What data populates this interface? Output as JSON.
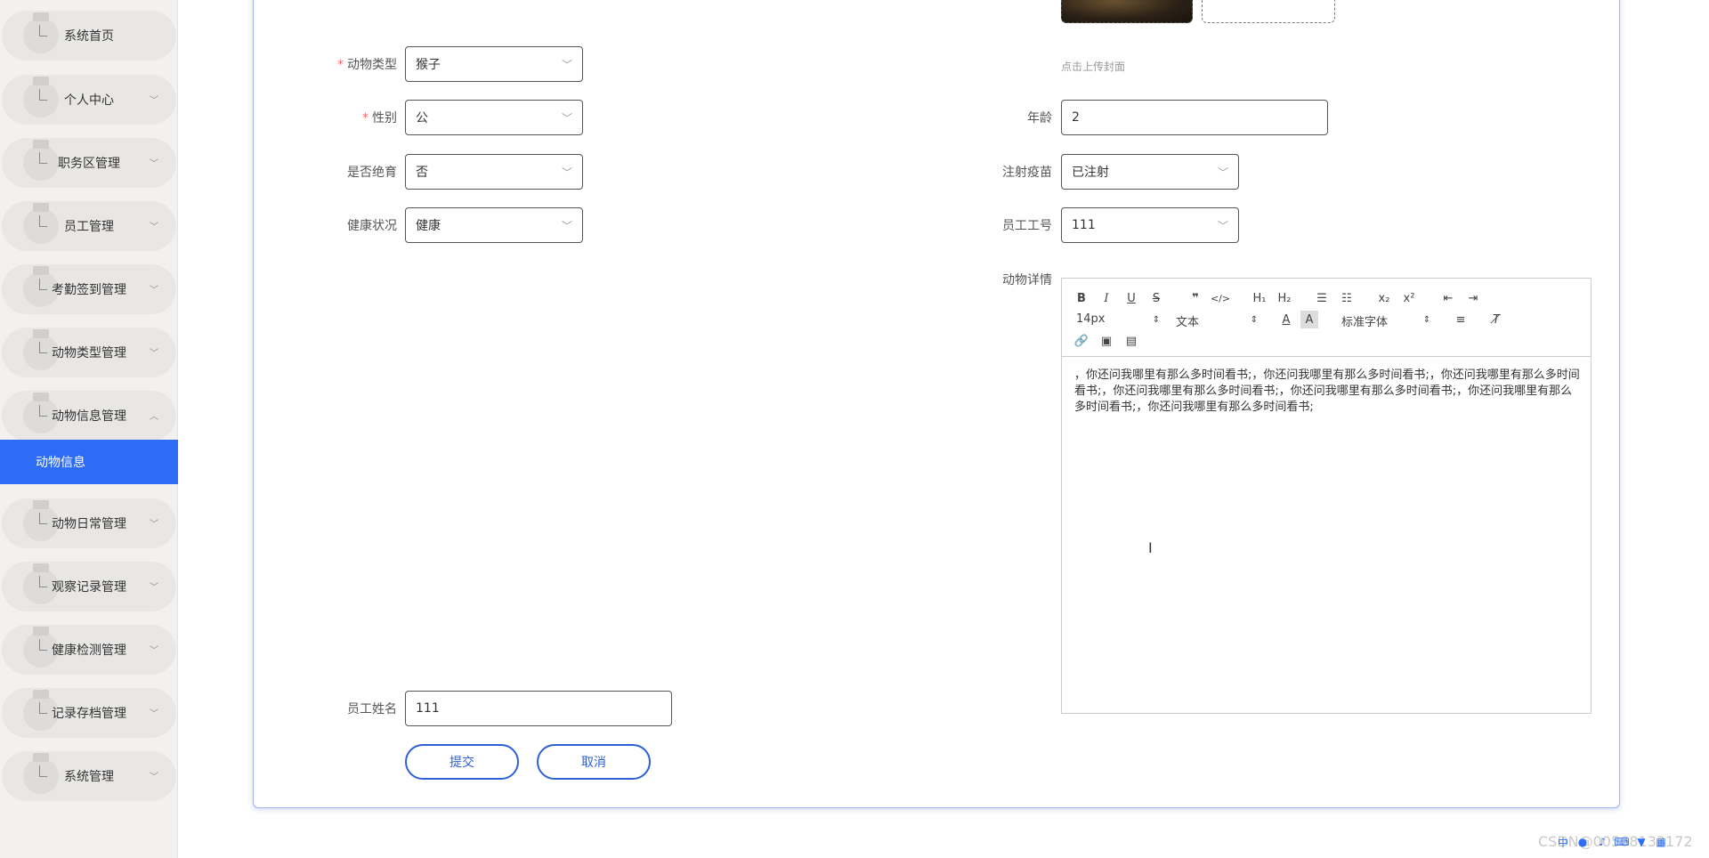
{
  "sidebar": {
    "items": [
      {
        "label": "系统首页",
        "has_arrow": false
      },
      {
        "label": "个人中心",
        "has_arrow": true
      },
      {
        "label": "职务区管理",
        "has_arrow": true
      },
      {
        "label": "员工管理",
        "has_arrow": true
      },
      {
        "label": "考勤签到管理",
        "has_arrow": true
      },
      {
        "label": "动物类型管理",
        "has_arrow": true
      },
      {
        "label": "动物信息管理",
        "has_arrow": true,
        "expanded": true
      },
      {
        "label": "动物日常管理",
        "has_arrow": true
      },
      {
        "label": "观察记录管理",
        "has_arrow": true
      },
      {
        "label": "健康检测管理",
        "has_arrow": true
      },
      {
        "label": "记录存档管理",
        "has_arrow": true
      },
      {
        "label": "系统管理",
        "has_arrow": true
      }
    ],
    "active_sub": "动物信息"
  },
  "form": {
    "upload_hint": "点击上传封面",
    "animal_type": {
      "label": "动物类型",
      "value": "猴子"
    },
    "gender": {
      "label": "性别",
      "value": "公"
    },
    "age": {
      "label": "年龄",
      "value": "2"
    },
    "sterilized": {
      "label": "是否绝育",
      "value": "否"
    },
    "vaccine": {
      "label": "注射疫苗",
      "value": "已注射"
    },
    "health": {
      "label": "健康状况",
      "value": "健康"
    },
    "employee_id": {
      "label": "员工工号",
      "value": "111"
    },
    "details_label": "动物详情",
    "employee_name": {
      "label": "员工姓名",
      "value": "111"
    },
    "submit": "提交",
    "cancel": "取消"
  },
  "editor": {
    "font_size": "14px",
    "block_type": "文本",
    "font_family": "标准字体",
    "content": "，你还问我哪里有那么多时间看书;，你还问我哪里有那么多时间看书;，你还问我哪里有那么多时间看书;，你还问我哪里有那么多时间看书;，你还问我哪里有那么多时间看书;，你还问我哪里有那么多时间看书;，你还问我哪里有那么多时间看书;"
  },
  "watermark": "CSDN@00568133172",
  "colors": {
    "accent": "#2d6df6",
    "button_border": "#2d5fd6",
    "required": "#f56c6c"
  }
}
